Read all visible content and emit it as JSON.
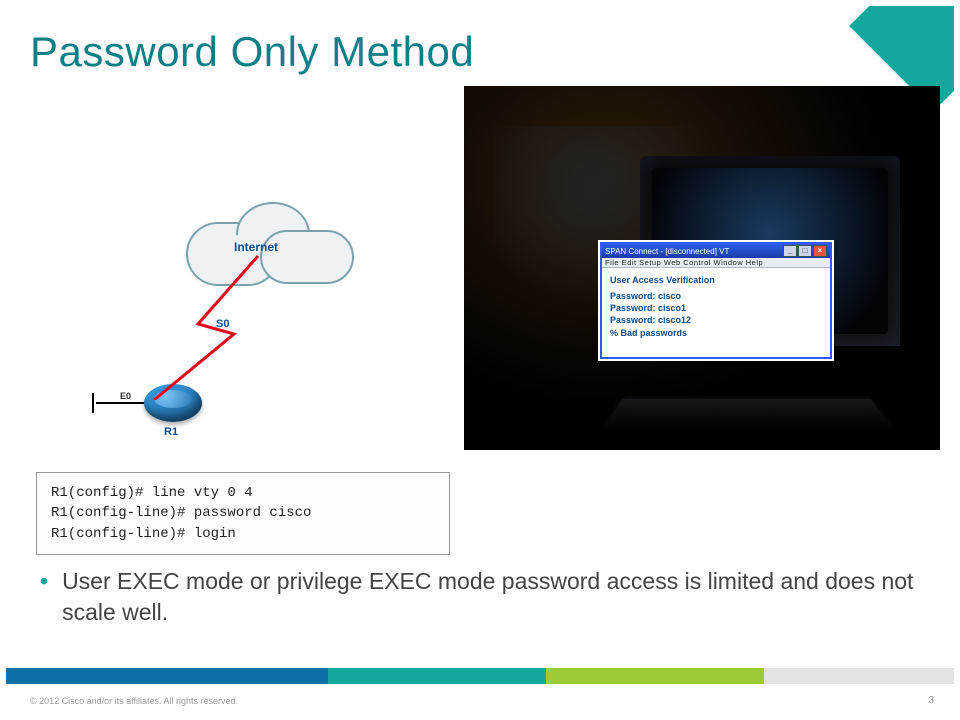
{
  "title": "Password Only Method",
  "diagram": {
    "cloud_label": "Internet",
    "serial_label": "S0",
    "eth_label": "E0",
    "router_label": "R1"
  },
  "terminal": {
    "window_title": "SPAN Connect - [disconnected] VT",
    "menu": "File  Edit  Setup  Web  Control  Window  Help",
    "heading": "User Access Verification",
    "lines": [
      "Password: cisco",
      "Password: cisco1",
      "Password: cisco12",
      "% Bad passwords"
    ]
  },
  "code": {
    "line1": "R1(config)# line vty 0 4",
    "line2": "R1(config-line)# password cisco",
    "line3": "R1(config-line)# login"
  },
  "bullet": "User EXEC mode or privilege EXEC mode password access is limited and does not scale well.",
  "footer": {
    "copyright": "© 2012 Cisco and/or its affiliates. All rights reserved.",
    "page": "3"
  }
}
